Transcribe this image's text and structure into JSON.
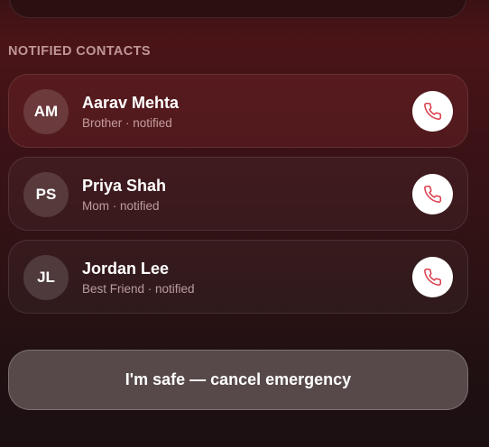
{
  "section": {
    "title": "NOTIFIED CONTACTS"
  },
  "contacts": [
    {
      "initials": "AM",
      "name": "Aarav Mehta",
      "subtitle": "Brother · notified",
      "icon": "phone-icon"
    },
    {
      "initials": "PS",
      "name": "Priya Shah",
      "subtitle": "Mom · notified",
      "icon": "phone-icon"
    },
    {
      "initials": "JL",
      "name": "Jordan Lee",
      "subtitle": "Best Friend · notified",
      "icon": "phone-icon"
    }
  ],
  "actions": {
    "cancel_label": "I'm safe — cancel emergency"
  },
  "colors": {
    "accent_red": "#d9414f",
    "button_bg": "#57494a"
  }
}
